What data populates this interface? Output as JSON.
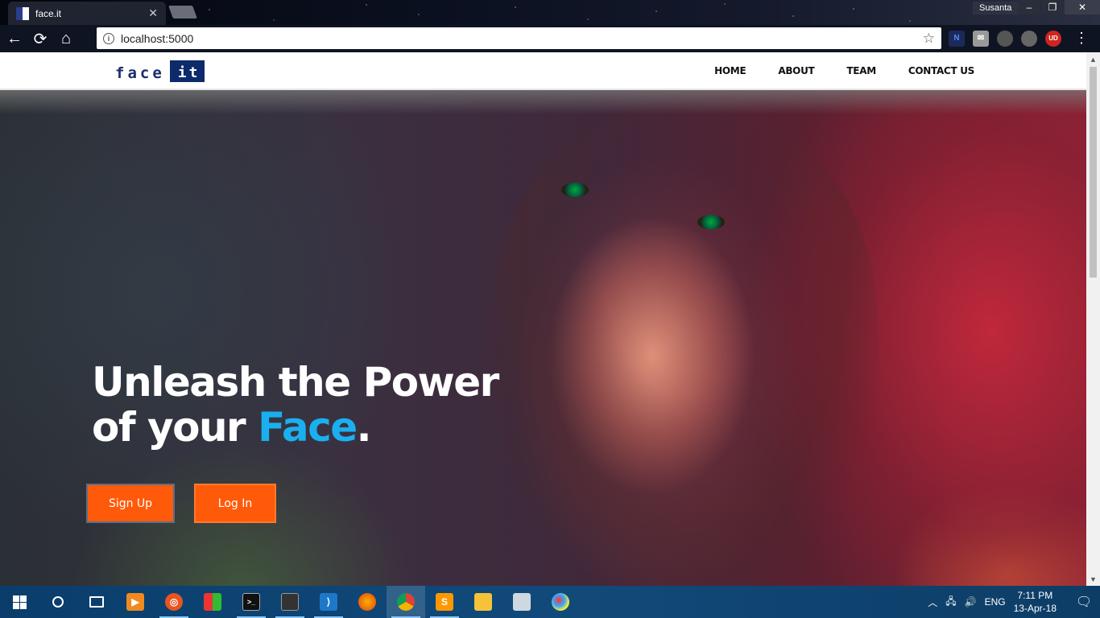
{
  "browser": {
    "tab_title": "face.it",
    "profile_name": "Susanta",
    "url": "localhost:5000",
    "window_controls": {
      "minimize": "–",
      "restore": "❐",
      "close": "✕"
    },
    "icons": [
      "back-icon",
      "reload-icon",
      "home-icon",
      "info-icon",
      "bookmark-star-icon",
      "extensions",
      "menu-icon"
    ],
    "extensions": [
      "N",
      "",
      "",
      "",
      "UD"
    ]
  },
  "site": {
    "logo": {
      "part1": "face",
      "part2": "it"
    },
    "nav": [
      {
        "label": "HOME"
      },
      {
        "label": "ABOUT"
      },
      {
        "label": "TEAM"
      },
      {
        "label": "CONTACT US"
      }
    ],
    "hero": {
      "headline_line1": "Unleash the Power",
      "headline_line2_prefix": "of your ",
      "headline_accent": "Face",
      "headline_suffix": ".",
      "accent_color": "#1ab0f0"
    },
    "buttons": {
      "signup": "Sign Up",
      "login": "Log In",
      "button_color": "#ff5a0a"
    }
  },
  "taskbar": {
    "language": "ENG",
    "time": "7:11 PM",
    "date": "13-Apr-18",
    "apps": [
      "start-icon",
      "search-icon",
      "task-view-icon",
      "media-player-icon",
      "ubuntu-icon",
      "windows-store-icon",
      "terminal-icon",
      "console-icon",
      "vscode-icon",
      "firefox-icon",
      "chrome-icon",
      "sublime-icon",
      "file-explorer-icon",
      "photo-icon",
      "paint-icon"
    ]
  }
}
